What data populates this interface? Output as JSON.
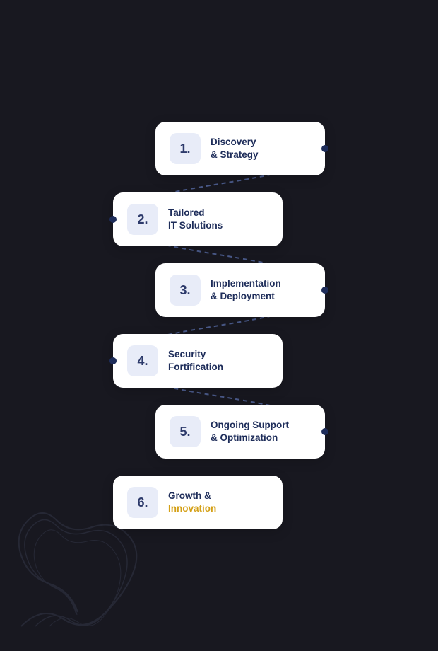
{
  "steps": [
    {
      "id": 1,
      "number": "1.",
      "line1": "Discovery",
      "line2": "& Strategy",
      "highlight": false,
      "align": "right",
      "dotSide": "right"
    },
    {
      "id": 2,
      "number": "2.",
      "line1": "Tailored",
      "line2": "IT Solutions",
      "highlight": false,
      "align": "left",
      "dotSide": "left"
    },
    {
      "id": 3,
      "number": "3.",
      "line1": "Implementation",
      "line2": "& Deployment",
      "highlight": false,
      "align": "right",
      "dotSide": "right"
    },
    {
      "id": 4,
      "number": "4.",
      "line1": "Security",
      "line2": "Fortification",
      "highlight": false,
      "align": "left",
      "dotSide": "left"
    },
    {
      "id": 5,
      "number": "5.",
      "line1": "Ongoing Support",
      "line2": "& Optimization",
      "highlight": false,
      "align": "right",
      "dotSide": "right"
    },
    {
      "id": 6,
      "number": "6.",
      "line1": "Growth &",
      "line2": "Innovation",
      "highlight": true,
      "highlightWord": "Innovation",
      "align": "left",
      "dotSide": "none"
    }
  ],
  "colors": {
    "bg": "#181820",
    "card": "#ffffff",
    "numberBox": "#e8ecf8",
    "numberText": "#2d3a6b",
    "labelText": "#1e2d5a",
    "highlight": "#d4a017",
    "dot": "#1e2d5a"
  }
}
